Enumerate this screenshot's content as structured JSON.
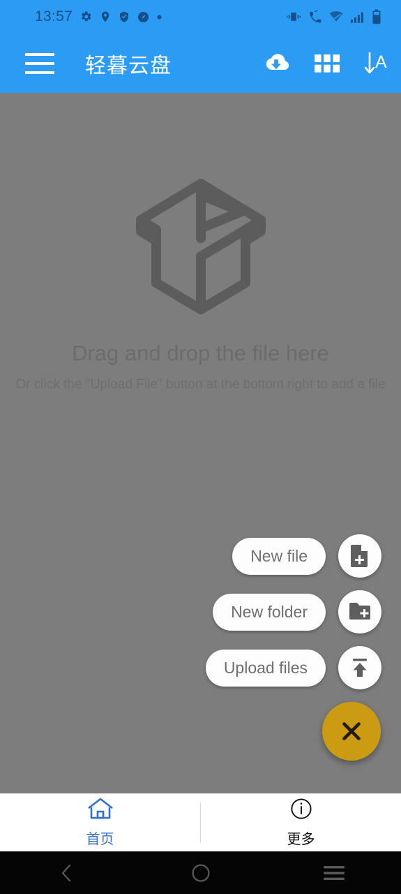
{
  "status_bar": {
    "time": "13:57",
    "left_icons": [
      "gear-icon",
      "location-pin-icon",
      "shield-check-icon",
      "speedometer-icon",
      "dot-icon"
    ],
    "right_icons": [
      "vibrate-icon",
      "call-off-icon",
      "wifi-off-icon",
      "signal-bars-icon",
      "battery-icon"
    ],
    "colors": {
      "bar": "#2b9bf4",
      "icon": "#16508a"
    }
  },
  "app_bar": {
    "menu_label": "menu",
    "title": "轻暮云盘",
    "actions": [
      {
        "name": "cloud-download-icon",
        "label": "cloud download"
      },
      {
        "name": "grid-view-icon",
        "label": "grid view"
      },
      {
        "name": "sort-alpha-icon",
        "label": "sort A-Z"
      }
    ],
    "colors": {
      "background": "#2b9bf4",
      "foreground": "#ffffff"
    }
  },
  "empty_state": {
    "icon": "open-box-icon",
    "title": "Drag and drop the file here",
    "subtitle": "Or click the \"Upload File\" button at the bottom right to add a file",
    "colors": {
      "scrim": "#7d7d7d",
      "text": "#6c6c6c"
    }
  },
  "speed_dial": {
    "expanded": true,
    "items": [
      {
        "label": "New file",
        "icon": "file-plus-icon"
      },
      {
        "label": "New folder",
        "icon": "folder-plus-icon"
      },
      {
        "label": "Upload files",
        "icon": "upload-icon"
      }
    ],
    "fab": {
      "icon": "close-icon",
      "color": "#cb9c12"
    }
  },
  "bottom_nav": {
    "items": [
      {
        "label": "首页",
        "icon": "home-icon",
        "active": true
      },
      {
        "label": "更多",
        "icon": "info-circle-icon",
        "active": false
      }
    ],
    "active_color": "#2f6fd0",
    "inactive_color": "#0f0f0f"
  },
  "system_nav": {
    "buttons": [
      {
        "name": "back-icon"
      },
      {
        "name": "home-circle-icon"
      },
      {
        "name": "recents-icon"
      }
    ],
    "color": "#050505"
  }
}
